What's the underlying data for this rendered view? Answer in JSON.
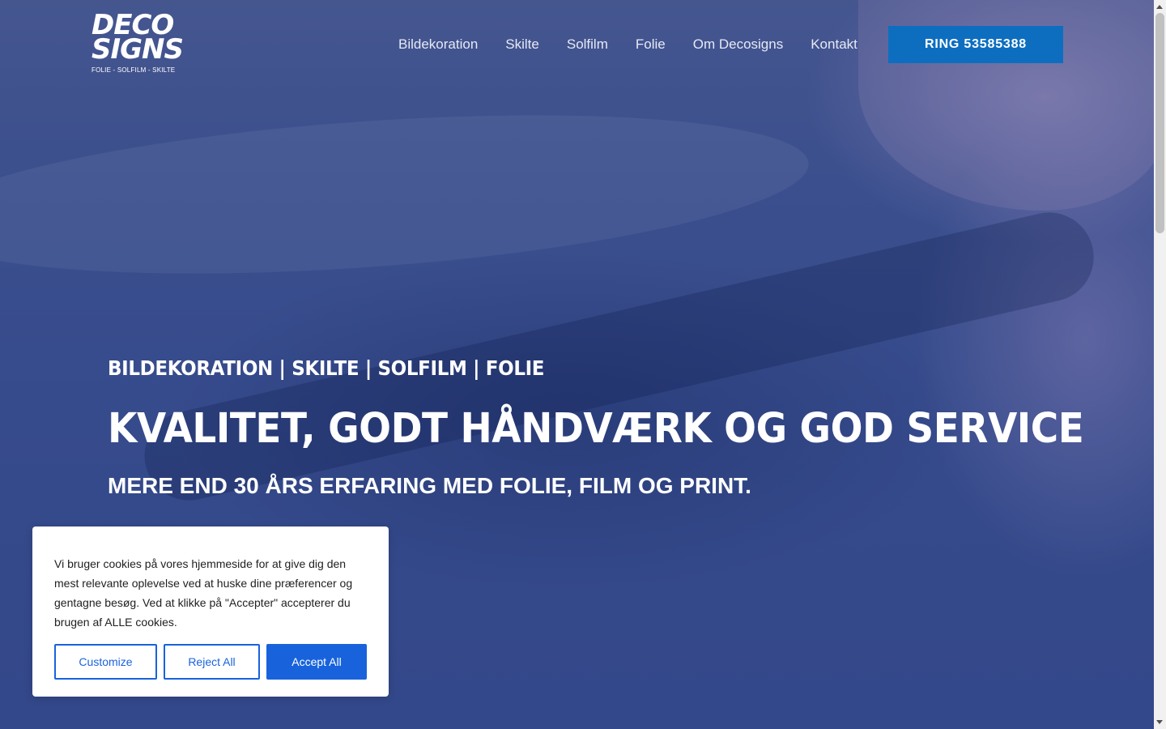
{
  "logo": {
    "line1": "DECO",
    "line2": "SIGNS",
    "tagline": "FOLIE - SOLFILM - SKILTE"
  },
  "nav": {
    "items": [
      {
        "label": "Bildekoration"
      },
      {
        "label": "Skilte"
      },
      {
        "label": "Solfilm"
      },
      {
        "label": "Folie"
      },
      {
        "label": "Om Decosigns"
      },
      {
        "label": "Kontakt"
      }
    ],
    "cta_label": "RING 53585388"
  },
  "hero": {
    "tagline": "BILDEKORATION | SKILTE | SOLFILM | FOLIE",
    "headline": "KVALITET, GODT HÅNDVÆRK OG GOD SERVICE",
    "subheadline": "MERE END 30 ÅRS ERFARING MED FOLIE, FILM OG PRINT."
  },
  "cookie_banner": {
    "text": "Vi bruger cookies på vores hjemmeside for at give dig den mest relevante oplevelse ved at huske dine præferencer og gentagne besøg. Ved at klikke på \"Accepter\" accepterer du brugen af ALLE cookies.",
    "customize_label": "Customize",
    "reject_label": "Reject All",
    "accept_label": "Accept All"
  },
  "colors": {
    "hero_overlay": "#3a4f8f",
    "cta": "#0d6ec0",
    "cookie_accent": "#1863dc"
  }
}
